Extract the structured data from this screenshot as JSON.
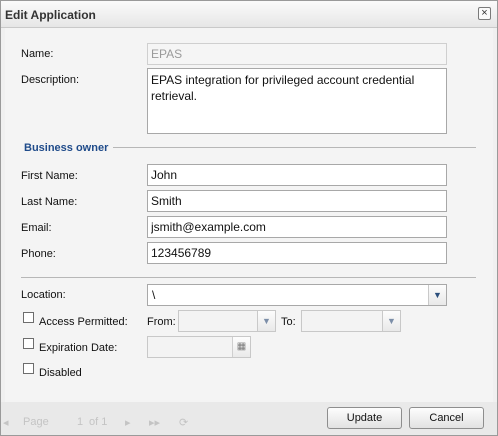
{
  "dialog": {
    "title": "Edit Application",
    "close_glyph": "×"
  },
  "form": {
    "name_label": "Name:",
    "name_value": "EPAS",
    "description_label": "Description:",
    "description_value": "EPAS integration for privileged account credential retrieval.",
    "business_owner_title": "Business owner",
    "first_name_label": "First Name:",
    "first_name_value": "John",
    "last_name_label": "Last Name:",
    "last_name_value": "Smith",
    "email_label": "Email:",
    "email_value": "jsmith@example.com",
    "phone_label": "Phone:",
    "phone_value": "123456789",
    "location_label": "Location:",
    "location_value": "\\",
    "access_permitted_label": "Access Permitted:",
    "access_permitted_checked": false,
    "from_label": "From:",
    "from_value": "",
    "to_label": "To:",
    "to_value": "",
    "expiration_date_label": "Expiration Date:",
    "expiration_date_checked": false,
    "expiration_date_value": "",
    "disabled_label": "Disabled",
    "disabled_checked": false
  },
  "footer": {
    "pager_page_label": "Page",
    "pager_page_value": "1",
    "pager_of_label": "of 1",
    "update_button": "Update",
    "cancel_button": "Cancel"
  },
  "icons": {
    "dropdown_arrow": "▼",
    "calendar": "▦"
  }
}
